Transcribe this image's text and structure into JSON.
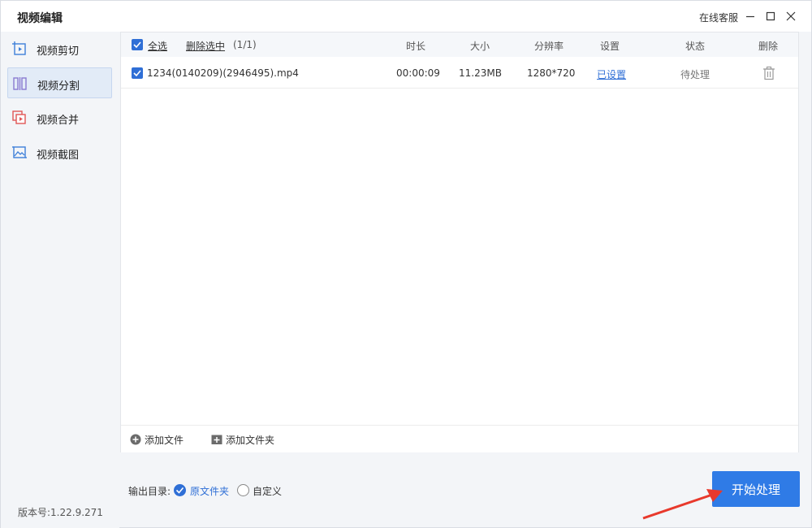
{
  "app": {
    "title": "视频编辑",
    "support": "在线客服"
  },
  "sidebar": {
    "items": [
      {
        "label": "视频剪切",
        "icon": "video-cut-icon",
        "active": false
      },
      {
        "label": "视频分割",
        "icon": "video-split-icon",
        "active": true
      },
      {
        "label": "视频合并",
        "icon": "video-merge-icon",
        "active": false
      },
      {
        "label": "视频截图",
        "icon": "video-screenshot-icon",
        "active": false
      }
    ],
    "version": "版本号:1.22.9.271"
  },
  "table": {
    "select_all": "全选",
    "delete_selected": "删除选中",
    "count": "(1/1)",
    "columns": {
      "duration": "时长",
      "size": "大小",
      "resolution": "分辨率",
      "settings": "设置",
      "status": "状态",
      "delete": "删除"
    },
    "rows": [
      {
        "name": "1234(0140209)(2946495).mp4",
        "duration": "00:00:09",
        "size": "11.23MB",
        "resolution": "1280*720",
        "settings": "已设置",
        "status": "待处理"
      }
    ]
  },
  "footer": {
    "add_file": "添加文件",
    "add_folder": "添加文件夹"
  },
  "output": {
    "label": "输出目录:",
    "option_original": "原文件夹",
    "option_custom": "自定义",
    "selected": "原文件夹"
  },
  "actions": {
    "start": "开始处理"
  },
  "colors": {
    "accent": "#2f7be6",
    "link": "#2f6fd6",
    "arrow": "#e8392c"
  }
}
